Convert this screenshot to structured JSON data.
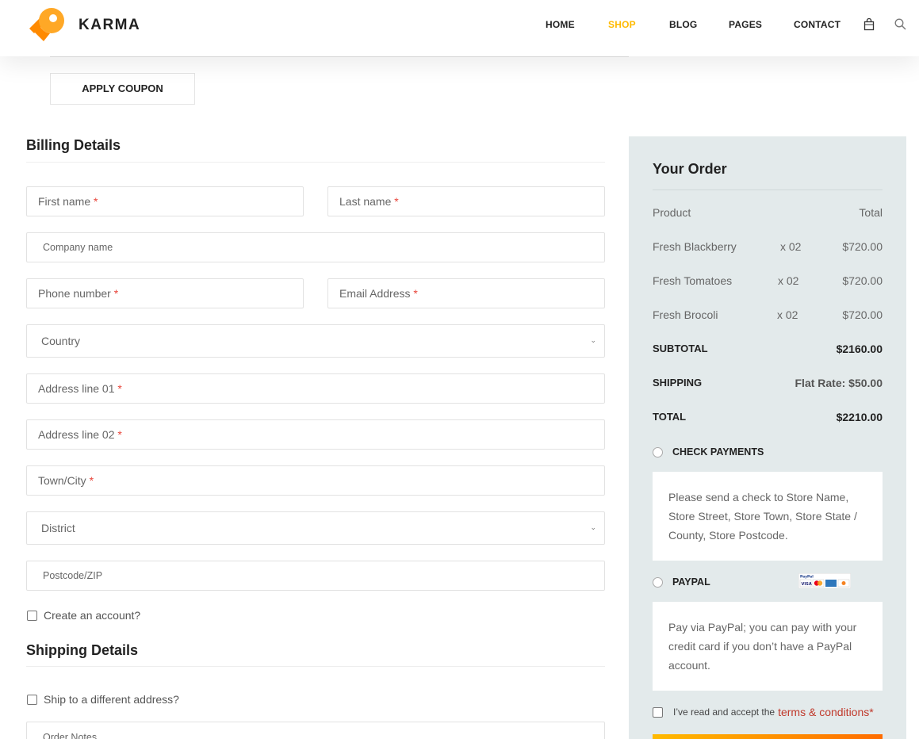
{
  "header": {
    "logo_text": "KARMA",
    "nav": [
      "HOME",
      "SHOP",
      "BLOG",
      "PAGES",
      "CONTACT"
    ],
    "active_nav": "SHOP",
    "icons": [
      "cart-icon",
      "search-icon"
    ],
    "accent_color": "#ffba00"
  },
  "coupon": {
    "apply_label": "APPLY COUPON"
  },
  "billing": {
    "title": "Billing Details",
    "first_name": "First name",
    "last_name": "Last name",
    "company": "Company name",
    "phone": "Phone number",
    "email": "Email Address",
    "country": "Country",
    "address1": "Address line 01",
    "address2": "Address line 02",
    "town": "Town/City",
    "district": "District",
    "postcode": "Postcode/ZIP",
    "required_mark": "*",
    "create_account": "Create an account?"
  },
  "shipping": {
    "title": "Shipping Details",
    "ship_different": "Ship to a different address?",
    "order_notes": "Order Notes"
  },
  "order": {
    "title": "Your Order",
    "head_product": "Product",
    "head_total": "Total",
    "items": [
      {
        "name": "Fresh Blackberry",
        "qty": "x 02",
        "total": "$720.00"
      },
      {
        "name": "Fresh Tomatoes",
        "qty": "x 02",
        "total": "$720.00"
      },
      {
        "name": "Fresh Brocoli",
        "qty": "x 02",
        "total": "$720.00"
      }
    ],
    "subtotal_label": "SUBTOTAL",
    "subtotal_value": "$2160.00",
    "shipping_label": "SHIPPING",
    "shipping_value": "Flat Rate: $50.00",
    "total_label": "TOTAL",
    "total_value": "$2210.00",
    "check_payments": "CHECK PAYMENTS",
    "check_desc": "Please send a check to Store Name, Store Street, Store Town, Store State / County, Store Postcode.",
    "paypal": "PAYPAL",
    "paypal_desc": "Pay via PayPal; you can pay with your credit card if you don’t have a PayPal account.",
    "terms_text": "I’ve read and accept the",
    "terms_link": "terms & conditions*"
  }
}
